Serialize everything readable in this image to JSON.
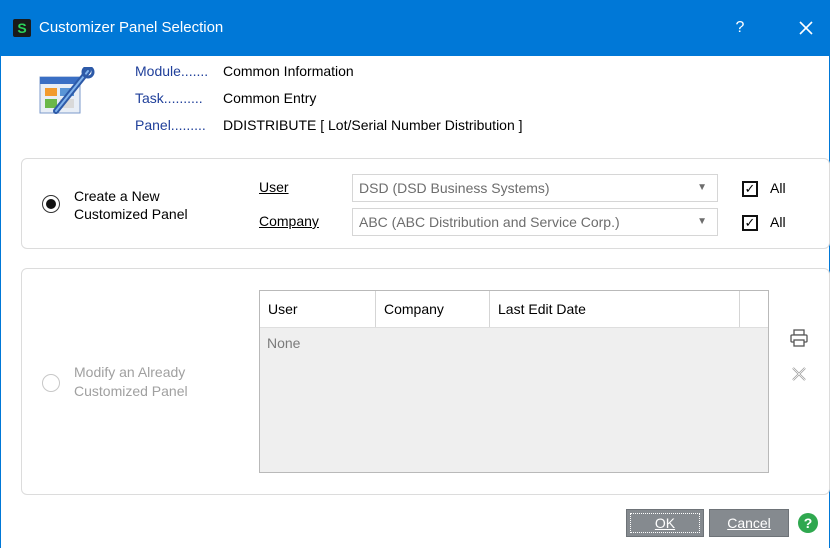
{
  "window": {
    "title": "Customizer Panel Selection",
    "app_icon_letter": "S",
    "help_label": "?",
    "accent": "#0078d7"
  },
  "info": {
    "module_label": "Module.......",
    "module_value": "Common Information",
    "task_label": "Task..........",
    "task_value": "Common Entry",
    "panel_label": "Panel.........",
    "panel_value": "DDISTRIBUTE   [ Lot/Serial Number Distribution ]"
  },
  "create": {
    "label_line1": "Create a New",
    "label_line2": "Customized Panel",
    "selected": true,
    "user_label": "User",
    "user_value": "DSD  (DSD Business Systems)",
    "company_label": "Company",
    "company_value": "ABC  (ABC Distribution and Service Corp.)",
    "user_all_label": "All",
    "company_all_label": "All",
    "user_all_checked": true,
    "company_all_checked": true
  },
  "modify": {
    "label_line1": "Modify an Already",
    "label_line2": "Customized Panel",
    "enabled": false,
    "columns": [
      "User",
      "Company",
      "Last Edit Date"
    ],
    "empty_text": "None"
  },
  "buttons": {
    "ok": "OK",
    "cancel": "Cancel"
  },
  "icons": [
    "app-icon",
    "help-icon",
    "close-icon",
    "customizer-icon",
    "printer-icon",
    "delete-icon",
    "help-circle-icon",
    "chevron-down-icon"
  ]
}
